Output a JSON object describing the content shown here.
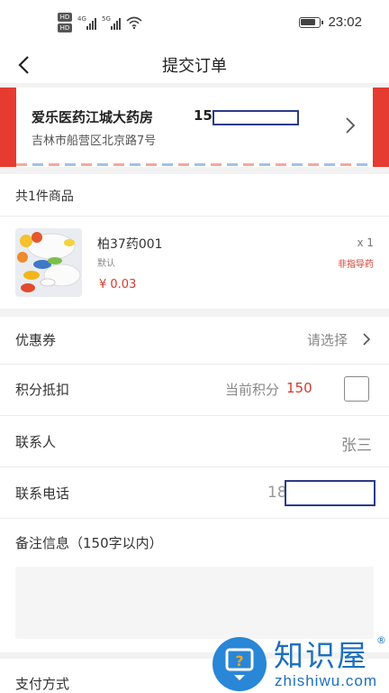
{
  "status_bar": {
    "network_labels": [
      "HD",
      "HD"
    ],
    "sim1_gen": "4G",
    "sim2_gen": "5G",
    "time": "23:02",
    "icons": [
      "signal-icon",
      "wifi-icon",
      "battery-icon"
    ]
  },
  "header": {
    "title": "提交订单",
    "back_icon": "chevron-left-icon"
  },
  "address": {
    "name": "爱乐医药江城大药房",
    "phone_visible": "15",
    "address": "吉林市船营区北京路7号",
    "accent_color": "#e53b30"
  },
  "goods": {
    "count_label": "共1件商品",
    "item": {
      "name": "柏37药001",
      "spec": "默认",
      "price": "¥ 0.03",
      "quantity": "x 1",
      "tag": "非指导药"
    }
  },
  "coupon": {
    "label": "优惠券",
    "value": "请选择"
  },
  "points": {
    "label": "积分抵扣",
    "prefix": "当前积分",
    "value": "150",
    "checked": false
  },
  "contact": {
    "label": "联系人",
    "value": "张三"
  },
  "phone": {
    "label": "联系电话",
    "value_visible": "18"
  },
  "remark": {
    "label": "备注信息（150字以内）",
    "placeholder": ""
  },
  "payment": {
    "label": "支付方式"
  },
  "watermark": {
    "name": "知识屋",
    "reg": "®",
    "domain": "zhishiwu.com"
  },
  "colors": {
    "price_red": "#d43a2c",
    "redact_border": "#2c3a8c",
    "watermark_blue": "#1e6fbe"
  }
}
